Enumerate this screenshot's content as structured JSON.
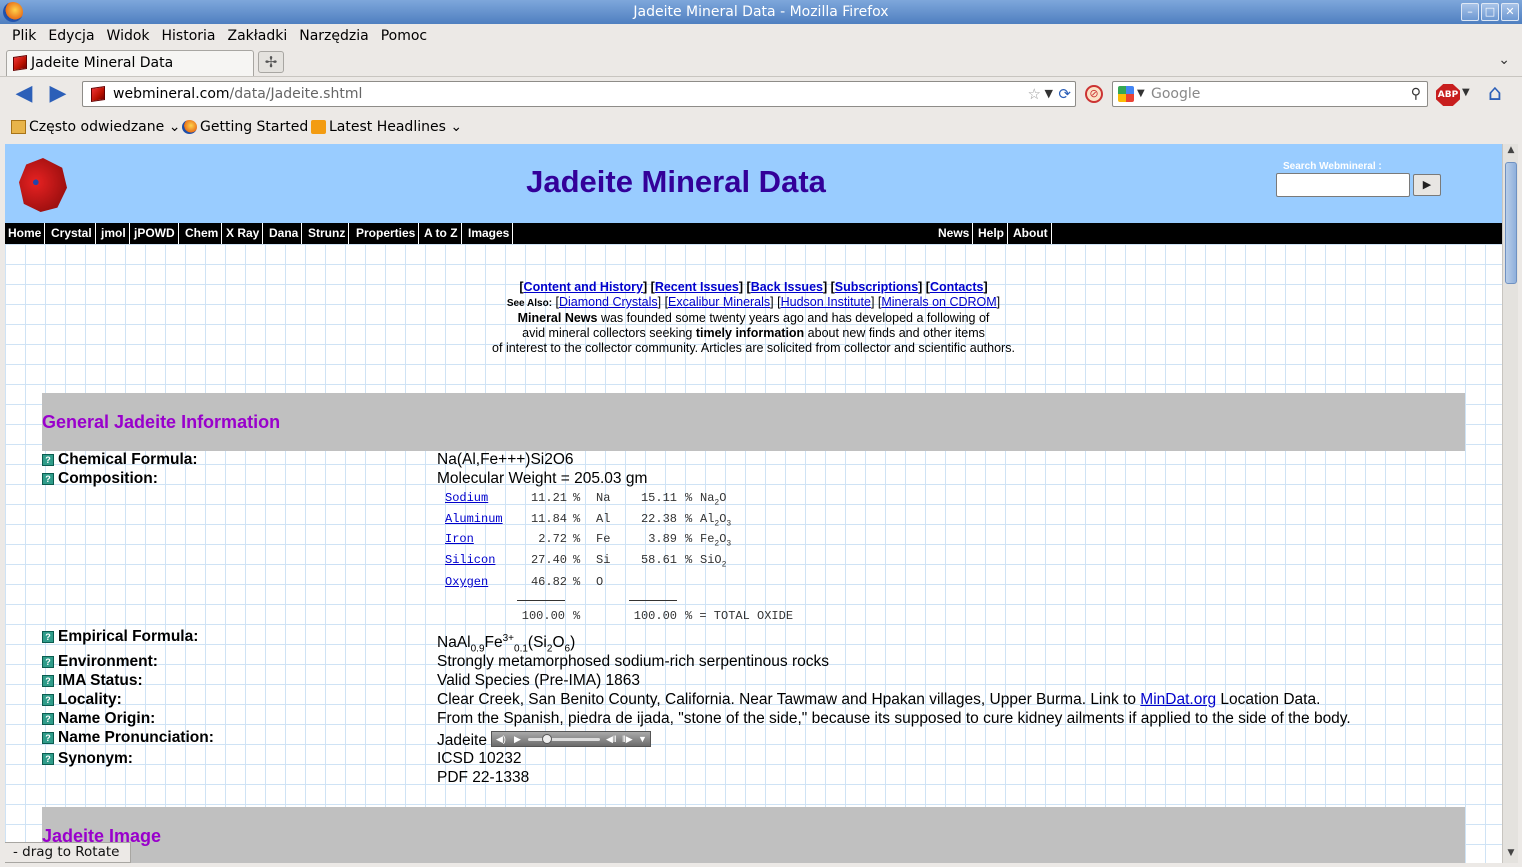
{
  "window": {
    "title": "Jadeite Mineral Data - Mozilla Firefox"
  },
  "menu": [
    "Plik",
    "Edycja",
    "Widok",
    "Historia",
    "Zakładki",
    "Narzędzia",
    "Pomoc"
  ],
  "tab": {
    "label": "Jadeite Mineral Data"
  },
  "nav": {
    "url_host": "webmineral.com",
    "url_path": "/data/Jadeite.shtml",
    "search_placeholder": "Google"
  },
  "bookmarks": [
    "Często odwiedzane",
    "Getting Started",
    "Latest Headlines"
  ],
  "site": {
    "title": "Jadeite Mineral Data",
    "search_label": "Search Webmineral :",
    "nav_left": [
      "Home",
      "Crystal",
      "jmol",
      "jPOWD",
      "Chem",
      "X Ray",
      "Dana",
      "Strunz",
      "Properties",
      "A to Z",
      "Images"
    ],
    "nav_right": [
      "News",
      "Help",
      "About"
    ]
  },
  "news": {
    "links": [
      "Content and History",
      "Recent Issues",
      "Back Issues",
      "Subscriptions",
      "Contacts"
    ],
    "see_also_label": "See Also:",
    "see_also": [
      "Diamond Crystals",
      "Excalibur Minerals",
      "Hudson Institute",
      "Minerals on CDROM"
    ],
    "line1_bold": "Mineral News",
    "line1_rest": " was founded some twenty years ago and has developed a following of",
    "line2_a": "avid mineral collectors seeking ",
    "line2_bold": "timely information",
    "line2_b": " about new finds and other items",
    "line3": "of interest to the collector community. Articles are solicited from collector and scientific authors."
  },
  "section_general": "General Jadeite Information",
  "section_image": "Jadeite Image",
  "rows": {
    "chemical_formula": {
      "label": "Chemical Formula:",
      "value": "Na(Al,Fe+++)Si2O6"
    },
    "composition": {
      "label": "Composition:",
      "value": "Molecular Weight = 205.03 gm"
    },
    "empirical": {
      "label": "Empirical Formula:"
    },
    "environment": {
      "label": "Environment:",
      "value": "Strongly metamorphosed sodium-rich serpentinous rocks"
    },
    "ima": {
      "label": "IMA Status:",
      "value": "Valid Species (Pre-IMA) 1863"
    },
    "locality": {
      "label": "Locality:",
      "value": "Clear Creek, San Benito County, California. Near Tawmaw and Hpakan villages, Upper Burma. Link to ",
      "link": "MinDat.org",
      "value_tail": " Location Data."
    },
    "name_origin": {
      "label": "Name Origin:",
      "value": "From the Spanish, piedra de ijada, \"stone of the side,\" because its supposed to cure kidney ailments if applied to the side of the body."
    },
    "pronunciation": {
      "label": "Name Pronunciation:",
      "value": "Jadeite"
    },
    "synonym": {
      "label": "Synonym:",
      "value1": "ICSD 10232",
      "value2": "PDF 22-1338"
    }
  },
  "composition_table": [
    {
      "element": "Sodium",
      "pct": "11.21",
      "sym": "Na",
      "oxide_pct": "15.11",
      "oxide": "Na",
      "oxide_sub1": "2",
      "oxide_b": "O",
      "oxide_sub2": ""
    },
    {
      "element": "Aluminum",
      "pct": "11.84",
      "sym": "Al",
      "oxide_pct": "22.38",
      "oxide": "Al",
      "oxide_sub1": "2",
      "oxide_b": "O",
      "oxide_sub2": "3"
    },
    {
      "element": "Iron",
      "pct": "2.72",
      "sym": "Fe",
      "oxide_pct": "3.89",
      "oxide": "Fe",
      "oxide_sub1": "2",
      "oxide_b": "O",
      "oxide_sub2": "3"
    },
    {
      "element": "Silicon",
      "pct": "27.40",
      "sym": "Si",
      "oxide_pct": "58.61",
      "oxide": "SiO",
      "oxide_sub1": "",
      "oxide_b": "",
      "oxide_sub2": "2"
    },
    {
      "element": "Oxygen",
      "pct": "46.82",
      "sym": "O",
      "oxide_pct": "",
      "oxide": "",
      "oxide_sub1": "",
      "oxide_b": "",
      "oxide_sub2": ""
    }
  ],
  "composition_total": {
    "pct": "100.00",
    "oxide_pct": "100.00",
    "oxide_label": "= TOTAL OXIDE"
  },
  "status_tip": "- drag to Rotate",
  "colors": {
    "header_bg": "#99ccff",
    "title": "#330099",
    "section_title": "#9900cc",
    "section_bg": "#c0c0c0",
    "nav_bg": "#000000"
  }
}
